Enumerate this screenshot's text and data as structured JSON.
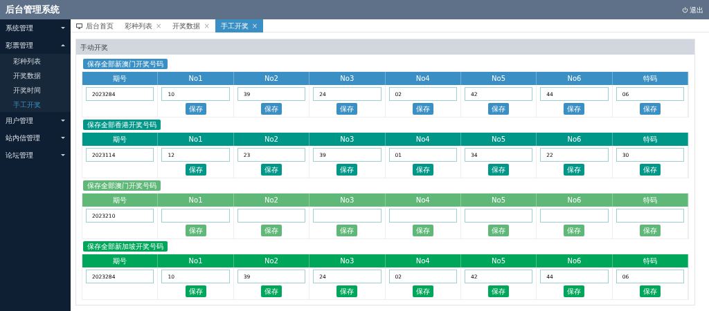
{
  "header": {
    "title": "后台管理系统",
    "logout": "退出"
  },
  "sidebar": {
    "items": [
      {
        "label": "系统管理",
        "expanded": false
      },
      {
        "label": "彩票管理",
        "expanded": true,
        "children": [
          {
            "label": "彩种列表",
            "selected": false
          },
          {
            "label": "开奖数据",
            "selected": false
          },
          {
            "label": "开奖时间",
            "selected": false
          },
          {
            "label": "手工开奖",
            "selected": true
          }
        ]
      },
      {
        "label": "用户管理",
        "expanded": false
      },
      {
        "label": "站内信管理",
        "expanded": false
      },
      {
        "label": "论坛管理",
        "expanded": false
      }
    ]
  },
  "tabs": [
    {
      "kind": "home",
      "label": "后台首页",
      "selected": false
    },
    {
      "kind": "page",
      "label": "彩种列表",
      "close": "×",
      "selected": false
    },
    {
      "kind": "page",
      "label": "开奖数据",
      "close": "×",
      "selected": false
    },
    {
      "kind": "page",
      "label": "手工开奖",
      "close": "×",
      "selected": true
    }
  ],
  "panel": {
    "title": "手动开奖",
    "sections": [
      {
        "save_all": "保存全部新澳门开奖号码",
        "color": "#3a8fc4",
        "columns": [
          "期号",
          "No1",
          "No2",
          "No3",
          "No4",
          "No5",
          "No6",
          "特码"
        ],
        "cells": [
          {
            "value": "2023284"
          },
          {
            "value": "10",
            "button": "保存"
          },
          {
            "value": "39",
            "button": "保存"
          },
          {
            "value": "24",
            "button": "保存"
          },
          {
            "value": "02",
            "button": "保存"
          },
          {
            "value": "42",
            "button": "保存"
          },
          {
            "value": "44",
            "button": "保存"
          },
          {
            "value": "06",
            "button": "保存"
          }
        ]
      },
      {
        "save_all": "保存全部香港开奖号码",
        "color": "#009688",
        "columns": [
          "期号",
          "No1",
          "No2",
          "No3",
          "No4",
          "No5",
          "No6",
          "特码"
        ],
        "cells": [
          {
            "value": "2023114"
          },
          {
            "value": "12",
            "button": "保存"
          },
          {
            "value": "23",
            "button": "保存"
          },
          {
            "value": "39",
            "button": "保存"
          },
          {
            "value": "01",
            "button": "保存"
          },
          {
            "value": "34",
            "button": "保存"
          },
          {
            "value": "22",
            "button": "保存"
          },
          {
            "value": "30",
            "button": "保存"
          }
        ]
      },
      {
        "save_all": "保存全部澳门开奖号码",
        "color": "#5fb878",
        "columns": [
          "期号",
          "No1",
          "No2",
          "No3",
          "No4",
          "No5",
          "No6",
          "特码"
        ],
        "cells": [
          {
            "value": "2023210"
          },
          {
            "button": "保存"
          },
          {
            "button": "保存"
          },
          {
            "button": "保存"
          },
          {
            "button": "保存"
          },
          {
            "button": "保存"
          },
          {
            "button": "保存"
          },
          {
            "button": "保存"
          }
        ]
      },
      {
        "save_all": "保存全部新加坡开奖号码",
        "color": "#00a65a",
        "columns": [
          "期号",
          "No1",
          "No2",
          "No3",
          "No4",
          "No5",
          "No6",
          "特码"
        ],
        "cells": [
          {
            "value": "2023284"
          },
          {
            "value": "10",
            "button": "保存"
          },
          {
            "value": "39",
            "button": "保存"
          },
          {
            "value": "24",
            "button": "保存"
          },
          {
            "value": "02",
            "button": "保存"
          },
          {
            "value": "42",
            "button": "保存"
          },
          {
            "value": "44",
            "button": "保存"
          },
          {
            "value": "06",
            "button": "保存"
          }
        ]
      }
    ]
  }
}
